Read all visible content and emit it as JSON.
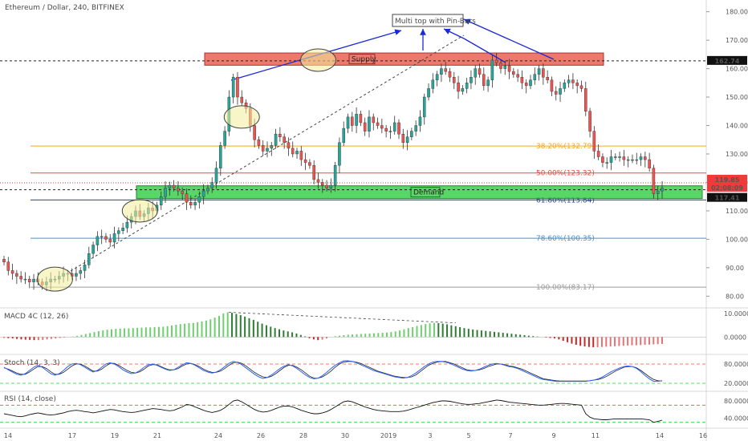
{
  "chart_data": {
    "type": "candlestick",
    "title": "Ethereum / Dollar, 240, BITFINEX",
    "annotation": "Multi top with Pin-Bars",
    "colors": {
      "up": "#26a69a",
      "down": "#ef5350",
      "wick": "#333333",
      "supply": "#e74c3c",
      "demand": "#2ecc40",
      "stoch_k": "#2962ff",
      "stoch_d": "#222222"
    },
    "price_axis": {
      "ticks": [
        80,
        90,
        100,
        110,
        120,
        130,
        140,
        150,
        160,
        170,
        180
      ],
      "labels": [
        "80.00",
        "90.00",
        "100.00",
        "110.00",
        "120.00",
        "130.00",
        "140.00",
        "150.00",
        "160.00",
        "170.00",
        "180.00"
      ],
      "range": [
        77,
        183
      ]
    },
    "x_axis": {
      "labels": [
        "14",
        "17",
        "19",
        "21",
        "24",
        "26",
        "28",
        "30",
        "2019",
        "3",
        "5",
        "7",
        "9",
        "11",
        "14",
        "16"
      ]
    },
    "price_badges": [
      {
        "price": 162.74,
        "text": "162.74",
        "bg": "#111111",
        "fg": "#ffffff"
      },
      {
        "price": 119.85,
        "text": "119.85",
        "bg": "#ef3b3b",
        "fg": "#ffffff"
      },
      {
        "price": 119.5,
        "text": "02:08:09",
        "bg": "#ef3b3b",
        "fg": "#ffffff"
      },
      {
        "price": 117.41,
        "text": "117.41",
        "bg": "#111111",
        "fg": "#ffffff"
      }
    ],
    "supply_zone": {
      "label": "Supply",
      "top": 165.5,
      "bottom": 161.2
    },
    "demand_zone": {
      "label": "Demand",
      "top": 118.8,
      "bottom": 114.3
    },
    "fib_levels": [
      {
        "label": "38.20%(132.79)",
        "price": 132.79,
        "color": "#f5a623"
      },
      {
        "label": "50.00%(123.32)",
        "price": 123.32,
        "color": "#e74c3c"
      },
      {
        "label": "61.80%(113.84)",
        "price": 113.84,
        "color": "#2c3ea8"
      },
      {
        "label": "78.60%(100.35)",
        "price": 100.35,
        "color": "#4a90c8"
      },
      {
        "label": "100.00%(83.17)",
        "price": 83.17,
        "color": "#9b9b9b"
      }
    ],
    "candles": [
      92,
      89,
      88,
      87,
      86,
      86,
      85,
      86,
      85,
      84,
      85,
      86,
      86,
      87,
      88,
      88,
      87,
      88,
      89,
      91,
      95,
      98,
      101,
      101,
      100,
      99,
      102,
      103,
      104,
      106,
      108,
      110,
      108,
      109,
      111,
      110,
      112,
      115,
      118,
      119,
      118,
      117,
      116,
      113,
      112,
      113,
      115,
      117,
      118,
      120,
      125,
      133,
      138,
      150,
      157,
      150,
      148,
      146,
      140,
      135,
      133,
      131,
      132,
      133,
      137,
      136,
      134,
      132,
      130,
      131,
      128,
      127,
      126,
      121,
      120,
      119,
      118,
      119,
      126,
      134,
      139,
      143,
      140,
      144,
      141,
      138,
      143,
      141,
      140,
      139,
      138,
      138,
      141,
      137,
      134,
      136,
      138,
      140,
      143,
      150,
      153,
      156,
      158,
      160,
      159,
      157,
      155,
      152,
      153,
      155,
      157,
      160,
      158,
      154,
      156,
      163,
      162,
      160,
      161,
      159,
      158,
      157,
      155,
      154,
      156,
      158,
      160,
      157,
      156,
      152,
      151,
      153,
      155,
      156,
      155,
      154,
      153,
      145,
      138,
      131,
      129,
      127,
      127,
      129,
      129,
      129,
      128,
      128,
      128,
      128,
      129,
      128,
      125,
      116,
      117,
      118
    ],
    "ellipses": [
      {
        "candle": 12,
        "price": 86,
        "rx": 22,
        "ry": 15
      },
      {
        "candle": 32,
        "price": 110,
        "rx": 22,
        "ry": 14
      },
      {
        "candle": 56,
        "price": 143,
        "rx": 22,
        "ry": 14
      },
      {
        "candle": 74,
        "price": 163,
        "rx": 22,
        "ry": 14
      }
    ],
    "macd": {
      "label": "MACD 4C (12, 26)",
      "ticks": [
        "10.0000",
        "0.0000"
      ],
      "range": [
        -6,
        11
      ],
      "values": [
        -0.4,
        -0.5,
        -0.6,
        -0.8,
        -1,
        -1.1,
        -1.2,
        -1.3,
        -1.3,
        -1.2,
        -1,
        -0.8,
        -0.6,
        -0.4,
        -0.2,
        0,
        0.2,
        0.5,
        0.9,
        1.3,
        1.7,
        2.1,
        2.5,
        2.8,
        3.1,
        3.3,
        3.5,
        3.6,
        3.7,
        3.7,
        3.8,
        3.9,
        4.0,
        4.1,
        4.1,
        4.2,
        4.3,
        4.4,
        4.6,
        4.9,
        5.2,
        5.5,
        5.7,
        5.9,
        6.0,
        6.3,
        6.6,
        7.0,
        7.5,
        8.2,
        9.0,
        10.0,
        10.5,
        10.3,
        9.8,
        9.3,
        8.7,
        8.0,
        7.3,
        6.5,
        5.7,
        5.0,
        4.4,
        3.8,
        3.3,
        2.8,
        2.4,
        2.0,
        1.5,
        0.9,
        0.3,
        -0.5,
        -1.0,
        -1.3,
        -1.1,
        -0.6,
        0.0,
        0.4,
        0.6,
        0.8,
        1.0,
        1.1,
        1.2,
        1.3,
        1.4,
        1.5,
        1.6,
        1.7,
        1.8,
        1.9,
        2.1,
        2.4,
        2.8,
        3.3,
        3.8,
        4.2,
        4.7,
        5.1,
        5.5,
        5.8,
        6.0,
        5.9,
        5.7,
        5.4,
        5.0,
        4.6,
        4.2,
        3.8,
        3.5,
        3.2,
        3.0,
        2.8,
        2.6,
        2.4,
        2.2,
        2.0,
        1.8,
        1.6,
        1.4,
        1.2,
        1.0,
        0.8,
        0.6,
        0.4,
        0.2,
        0.0,
        -0.2,
        -0.4,
        -0.6,
        -1.0,
        -1.6,
        -2.2,
        -2.8,
        -3.3,
        -3.7,
        -4.0,
        -4.2,
        -4.3,
        -4.3,
        -4.2,
        -4.1,
        -4.0,
        -3.9,
        -3.8,
        -3.7,
        -3.6,
        -3.5,
        -3.5,
        -3.4,
        -3.3,
        -3.2,
        -3.1,
        -3.0,
        -2.9
      ]
    },
    "stoch": {
      "label": "Stoch (14, 3, 3)",
      "ticks": [
        "80.0000",
        "20.0000"
      ],
      "range": [
        0,
        100
      ],
      "k": [
        70,
        62,
        55,
        48,
        45,
        50,
        60,
        70,
        76,
        70,
        60,
        50,
        45,
        50,
        60,
        72,
        80,
        82,
        78,
        70,
        62,
        55,
        60,
        70,
        80,
        84,
        80,
        72,
        62,
        55,
        50,
        52,
        60,
        70,
        78,
        80,
        76,
        70,
        64,
        60,
        62,
        70,
        78,
        84,
        82,
        76,
        68,
        60,
        55,
        52,
        55,
        62,
        72,
        82,
        88,
        85,
        78,
        68,
        58,
        48,
        40,
        35,
        38,
        46,
        56,
        66,
        74,
        78,
        74,
        66,
        56,
        46,
        38,
        34,
        36,
        44,
        54,
        66,
        76,
        84,
        90,
        90,
        88,
        84,
        78,
        72,
        66,
        60,
        56,
        52,
        48,
        44,
        40,
        38,
        36,
        38,
        44,
        52,
        62,
        72,
        80,
        86,
        88,
        88,
        86,
        82,
        76,
        70,
        64,
        60,
        58,
        60,
        64,
        70,
        76,
        80,
        82,
        80,
        76,
        72,
        70,
        66,
        60,
        54,
        48,
        42,
        36,
        32,
        30,
        28,
        26,
        26,
        26,
        26,
        26,
        26,
        26,
        26,
        28,
        30,
        34,
        40,
        48,
        56,
        62,
        68,
        72,
        74,
        72,
        66,
        56,
        44,
        34,
        26,
        26,
        28
      ],
      "d": [
        68,
        64,
        58,
        52,
        48,
        48,
        55,
        64,
        72,
        72,
        66,
        56,
        48,
        48,
        54,
        64,
        74,
        80,
        80,
        74,
        66,
        58,
        58,
        64,
        74,
        82,
        82,
        76,
        68,
        60,
        54,
        52,
        56,
        64,
        74,
        78,
        78,
        72,
        66,
        62,
        62,
        66,
        74,
        80,
        82,
        78,
        72,
        64,
        58,
        54,
        54,
        58,
        66,
        76,
        84,
        86,
        82,
        74,
        64,
        54,
        46,
        40,
        38,
        42,
        50,
        60,
        70,
        76,
        76,
        70,
        62,
        52,
        42,
        36,
        36,
        40,
        48,
        58,
        70,
        80,
        86,
        88,
        88,
        86,
        82,
        76,
        70,
        64,
        58,
        54,
        50,
        46,
        42,
        40,
        38,
        38,
        40,
        46,
        56,
        66,
        76,
        82,
        86,
        88,
        88,
        84,
        80,
        74,
        68,
        62,
        60,
        60,
        62,
        66,
        72,
        76,
        80,
        80,
        78,
        74,
        72,
        68,
        64,
        58,
        52,
        46,
        40,
        34,
        32,
        30,
        28,
        27,
        27,
        27,
        27,
        27,
        27,
        27,
        28,
        30,
        32,
        36,
        42,
        50,
        58,
        64,
        70,
        72,
        72,
        68,
        60,
        50,
        40,
        32,
        28,
        27
      ]
    },
    "rsi": {
      "label": "RSI (14, close)",
      "ticks": [
        "80.0000",
        "40.0000"
      ],
      "range": [
        20,
        95
      ],
      "values": [
        50,
        48,
        46,
        44,
        43,
        45,
        48,
        50,
        52,
        50,
        48,
        47,
        48,
        50,
        52,
        55,
        57,
        58,
        57,
        55,
        54,
        52,
        54,
        56,
        58,
        60,
        59,
        57,
        55,
        54,
        53,
        54,
        56,
        58,
        60,
        62,
        61,
        60,
        58,
        57,
        58,
        62,
        66,
        72,
        70,
        66,
        62,
        58,
        55,
        53,
        55,
        58,
        64,
        72,
        80,
        82,
        78,
        72,
        66,
        60,
        56,
        54,
        55,
        58,
        62,
        66,
        68,
        68,
        66,
        62,
        58,
        55,
        52,
        50,
        50,
        52,
        55,
        60,
        66,
        72,
        78,
        80,
        78,
        74,
        70,
        66,
        63,
        60,
        58,
        57,
        56,
        55,
        55,
        55,
        56,
        58,
        61,
        64,
        67,
        70,
        73,
        76,
        78,
        80,
        80,
        79,
        77,
        75,
        73,
        72,
        72,
        73,
        74,
        76,
        78,
        80,
        82,
        81,
        79,
        77,
        76,
        75,
        74,
        73,
        72,
        71,
        70,
        70,
        71,
        72,
        73,
        74,
        74,
        73,
        72,
        71,
        70,
        50,
        42,
        38,
        37,
        36,
        36,
        37,
        38,
        38,
        38,
        38,
        38,
        38,
        38,
        37,
        36,
        30,
        32,
        35
      ]
    }
  }
}
